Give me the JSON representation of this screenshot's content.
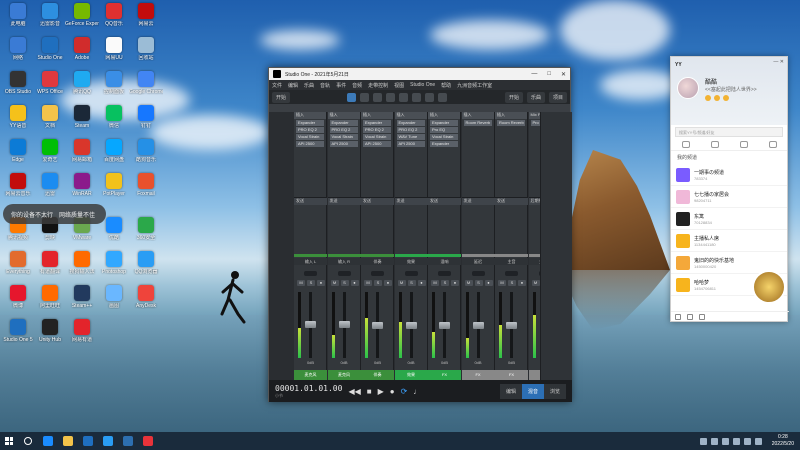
{
  "desktop": {
    "icons": [
      {
        "label": "此电脑",
        "color": "#3a7bd5"
      },
      {
        "label": "迅雷影音",
        "color": "#2d8fe0"
      },
      {
        "label": "GeForce Experience",
        "color": "#76b900"
      },
      {
        "label": "QQ音乐",
        "color": "#e03030"
      },
      {
        "label": "网易云",
        "color": "#c20c0c"
      },
      {
        "label": "网络",
        "color": "#3a7bd5"
      },
      {
        "label": "Studio One",
        "color": "#1f6fbf"
      },
      {
        "label": "Adobe",
        "color": "#d12c2c"
      },
      {
        "label": "网易UU",
        "color": "#fafafa"
      },
      {
        "label": "回收站",
        "color": "#9bbcd6"
      },
      {
        "label": "OBS Studio",
        "color": "#333333"
      },
      {
        "label": "WPS Office",
        "color": "#e0393e"
      },
      {
        "label": "腾讯QQ",
        "color": "#1faaf0"
      },
      {
        "label": "控制面板",
        "color": "#3a8ee6"
      },
      {
        "label": "Google Chrome",
        "color": "#4285f4"
      },
      {
        "label": "YY语音",
        "color": "#f5c11a"
      },
      {
        "label": "文档",
        "color": "#f3c34a"
      },
      {
        "label": "Steam",
        "color": "#1b2838"
      },
      {
        "label": "微信",
        "color": "#07c160"
      },
      {
        "label": "钉钉",
        "color": "#1677ff"
      },
      {
        "label": "Edge",
        "color": "#0c7bd6"
      },
      {
        "label": "爱奇艺",
        "color": "#00be06"
      },
      {
        "label": "网易邮箱",
        "color": "#d9362b"
      },
      {
        "label": "百度网盘",
        "color": "#06a7ff"
      },
      {
        "label": "酷狗音乐",
        "color": "#2590e6"
      },
      {
        "label": "网易云音乐",
        "color": "#c20c0c"
      },
      {
        "label": "迅雷",
        "color": "#1c8cf0"
      },
      {
        "label": "WinRAR",
        "color": "#8b1a8b"
      },
      {
        "label": "PotPlayer",
        "color": "#f2c21b"
      },
      {
        "label": "Foxmail",
        "color": "#e8512d"
      },
      {
        "label": "腾讯视频",
        "color": "#ff7a00"
      },
      {
        "label": "剪映",
        "color": "#111111"
      },
      {
        "label": "VMware",
        "color": "#6aa84f"
      },
      {
        "label": "优酷",
        "color": "#1a8cff"
      },
      {
        "label": "360安全",
        "color": "#2ba84a"
      },
      {
        "label": "Everything",
        "color": "#e26b2d"
      },
      {
        "label": "有道翻译",
        "color": "#e3242b"
      },
      {
        "label": "搜狗输入法",
        "color": "#ff6a00"
      },
      {
        "label": "Photoshop",
        "color": "#31a8ff"
      },
      {
        "label": "QQ浏览器",
        "color": "#2a9df4"
      },
      {
        "label": "微博",
        "color": "#e6162d"
      },
      {
        "label": "阿里旺旺",
        "color": "#ff6a00"
      },
      {
        "label": "Steam++",
        "color": "#223a5e"
      },
      {
        "label": "画图",
        "color": "#6ab7ff"
      },
      {
        "label": "AnyDesk",
        "color": "#ef443b"
      },
      {
        "label": "Studio One 5",
        "color": "#1f6fbf"
      },
      {
        "label": "Unity Hub",
        "color": "#222222"
      },
      {
        "label": "网易有道",
        "color": "#e3242b"
      }
    ]
  },
  "toast": {
    "left": "你的设备不太行",
    "right": "网络质量不佳"
  },
  "studio_one": {
    "title": "Studio One - 2021年5月21日",
    "window_controls": [
      "—",
      "□",
      "✕"
    ],
    "menu": [
      "文件",
      "编辑",
      "乐曲",
      "音轨",
      "事件",
      "音频",
      "走带控制",
      "视图",
      "Studio One",
      "帮助",
      "九洲音频工作室"
    ],
    "toolbar": {
      "left_select": "开始",
      "start_btn": "开始",
      "song_btn": "乐曲",
      "project_btn": "项目"
    },
    "left_panel": {
      "header": "默认",
      "items": [
        "输入",
        "输出",
        "外部",
        "乐器",
        "通道"
      ]
    },
    "channels": [
      {
        "insert_hdr": "插入",
        "plugins": [
          "Expander",
          "PRO EQ 2",
          "Vocal Strain",
          "API 2500"
        ],
        "send_hdr": "发送",
        "name": "输入 L",
        "volume": "0dB",
        "footer": "麦克风",
        "color": "#3b8f3b",
        "meter": 0.45,
        "fader": 0.52
      },
      {
        "insert_hdr": "插入",
        "plugins": [
          "Expander",
          "PRO EQ 2",
          "Vocal Strain",
          "API 2500"
        ],
        "send_hdr": "发送",
        "name": "输入 R",
        "volume": "0dB",
        "footer": "麦克风",
        "color": "#3b8f3b",
        "meter": 0.35,
        "fader": 0.52
      },
      {
        "insert_hdr": "插入",
        "plugins": [
          "Expander",
          "PRO EQ 2",
          "Vocal Strain",
          "API 2500"
        ],
        "send_hdr": "发送",
        "name": "伴奏",
        "volume": "0dB",
        "footer": "伴奏",
        "color": "#3b8f3b",
        "meter": 0.6,
        "fader": 0.5
      },
      {
        "insert_hdr": "插入",
        "plugins": [
          "Expander",
          "PRO EQ 2",
          "WAV Tune",
          "API 2500"
        ],
        "send_hdr": "发送",
        "name": "效果",
        "volume": "0dB",
        "footer": "效果",
        "color": "#2aa84a",
        "meter": 0.55,
        "fader": 0.5
      },
      {
        "insert_hdr": "插入",
        "plugins": [
          "Expander",
          "Pro EQ",
          "Vocal Strain",
          "Expander"
        ],
        "send_hdr": "发送",
        "name": "混响",
        "volume": "0dB",
        "footer": "FX",
        "color": "#2aa84a",
        "meter": 0.4,
        "fader": 0.5
      },
      {
        "insert_hdr": "插入",
        "plugins": [
          "Room Reverb"
        ],
        "send_hdr": "发送",
        "name": "延迟",
        "volume": "0dB",
        "footer": "FX",
        "color": "#888888",
        "meter": 0.3,
        "fader": 0.5
      },
      {
        "insert_hdr": "插入",
        "plugins": [
          "Room Reverb"
        ],
        "send_hdr": "发送",
        "name": "主音",
        "volume": "0dB",
        "footer": "FX",
        "color": "#888888",
        "meter": 0.5,
        "fader": 0.5
      },
      {
        "insert_hdr": "Mix FX",
        "plugins": [
          "Pro EQ"
        ],
        "send_hdr": "后期推子",
        "name": "主通道",
        "volume": "0dB",
        "footer": "主",
        "color": "#888888",
        "meter": 0.65,
        "fader": 0.55
      }
    ],
    "transport": {
      "time": "00001.01.01.00",
      "time_sub": "小节",
      "tabs": [
        "编辑",
        "混音",
        "浏览"
      ],
      "active_tab": "混音"
    }
  },
  "yy": {
    "app_name": "YY",
    "window_controls": "— ✕",
    "username": "酷酷",
    "status": "<<塞起此把陆人世界>>",
    "search_placeholder": "搜索YY号/频道/好友",
    "section": "我的频道",
    "channels": [
      {
        "title": "一期事の频道",
        "sub": "783374",
        "color": "#7a5cff"
      },
      {
        "title": "七七播の家居会",
        "sub": "98204711",
        "color": "#f0b8d8"
      },
      {
        "title": "东篱",
        "sub": "70128834",
        "color": "#222222"
      },
      {
        "title": "主播私人席",
        "sub": "1134441180",
        "color": "#f7b41d"
      },
      {
        "title": "鬼旧的的快乐基地",
        "sub": "1450000420",
        "color": "#f4a83a"
      },
      {
        "title": "哈哈梦",
        "sub": "1454706811",
        "color": "#f7b41d"
      }
    ]
  },
  "taskbar": {
    "apps": [
      {
        "name": "search",
        "color": "#ffffff"
      },
      {
        "name": "edge",
        "color": "#1a8cff"
      },
      {
        "name": "file-explorer",
        "color": "#f3c34a"
      },
      {
        "name": "studio-one",
        "color": "#1f6fbf"
      },
      {
        "name": "qq",
        "color": "#2a9df4"
      },
      {
        "name": "steam",
        "color": "#2d6fb0"
      },
      {
        "name": "yy",
        "color": "#e8333a"
      }
    ],
    "time": "0:28",
    "date": "2022/5/20"
  }
}
